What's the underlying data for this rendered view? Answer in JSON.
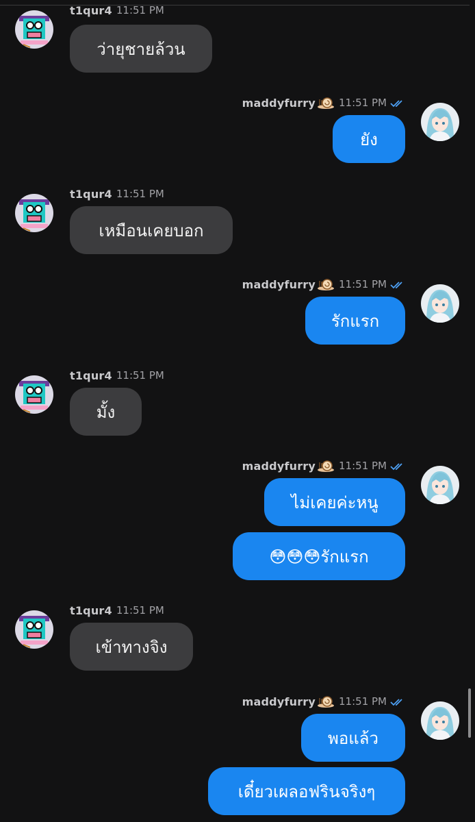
{
  "users": {
    "other": {
      "name": "t1qur4",
      "avatar_icon": "pixel-robot-avatar-icon"
    },
    "me": {
      "name": "maddyfurry",
      "badge_icon": "snail-badge-icon",
      "read_icon": "double-check-icon",
      "avatar_icon": "anime-girl-avatar-icon"
    }
  },
  "colors": {
    "background": "#121213",
    "incoming_bubble": "#3c3c3e",
    "outgoing_bubble": "#1a86f0",
    "read_ticks": "#4ea1f5"
  },
  "messages": [
    {
      "sender": "t1qur4",
      "time": "11:51 PM",
      "bubbles": [
        "ว่ายุชายล้วน"
      ]
    },
    {
      "sender": "maddyfurry",
      "time": "11:51 PM",
      "bubbles": [
        "ยัง"
      ]
    },
    {
      "sender": "t1qur4",
      "time": "11:51 PM",
      "bubbles": [
        "เหมือนเคยบอก"
      ]
    },
    {
      "sender": "maddyfurry",
      "time": "11:51 PM",
      "bubbles": [
        "รักแรก"
      ]
    },
    {
      "sender": "t1qur4",
      "time": "11:51 PM",
      "bubbles": [
        "มั้ง"
      ]
    },
    {
      "sender": "maddyfurry",
      "time": "11:51 PM",
      "bubbles": [
        "ไม่เคยค่ะหนู",
        "😳😳😳รักแรก"
      ]
    },
    {
      "sender": "t1qur4",
      "time": "11:51 PM",
      "bubbles": [
        "เข้าทางจิง"
      ]
    },
    {
      "sender": "maddyfurry",
      "time": "11:51 PM",
      "bubbles": [
        "พอแล้ว",
        "เดี๋ยวเผลอฟรินจริงๆ"
      ]
    }
  ]
}
